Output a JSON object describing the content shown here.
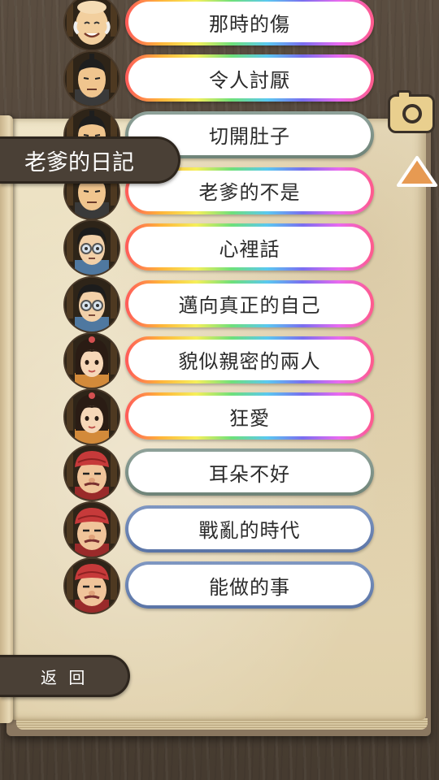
{
  "screen": {
    "title": "老爹的日記",
    "back_label": "返 回",
    "camera_icon": "camera-icon",
    "up_icon": "triangle-up-icon",
    "colors": {
      "tab_bg": "#4a4036",
      "camera_bg": "#e9cf8e",
      "arrow": "#e79a52",
      "page": "#efe5c8"
    }
  },
  "entries": [
    {
      "label": "那時的傷",
      "border": "rainbow",
      "character": "old-bald-man"
    },
    {
      "label": "令人討厭",
      "border": "rainbow",
      "character": "bald-man"
    },
    {
      "label": "切開肚子",
      "border": "gray",
      "character": "bald-man"
    },
    {
      "label": "老爹的不是",
      "border": "rainbow",
      "character": "bald-man"
    },
    {
      "label": "心裡話",
      "border": "rainbow",
      "character": "glasses-man"
    },
    {
      "label": "邁向真正的自己",
      "border": "rainbow",
      "character": "glasses-man"
    },
    {
      "label": "貌似親密的兩人",
      "border": "rainbow",
      "character": "woman"
    },
    {
      "label": "狂愛",
      "border": "rainbow",
      "character": "woman"
    },
    {
      "label": "耳朵不好",
      "border": "gray",
      "character": "red-hat-elder"
    },
    {
      "label": "戰亂的時代",
      "border": "blue",
      "character": "red-hat-elder"
    },
    {
      "label": "能做的事",
      "border": "blue",
      "character": "red-hat-elder"
    }
  ]
}
